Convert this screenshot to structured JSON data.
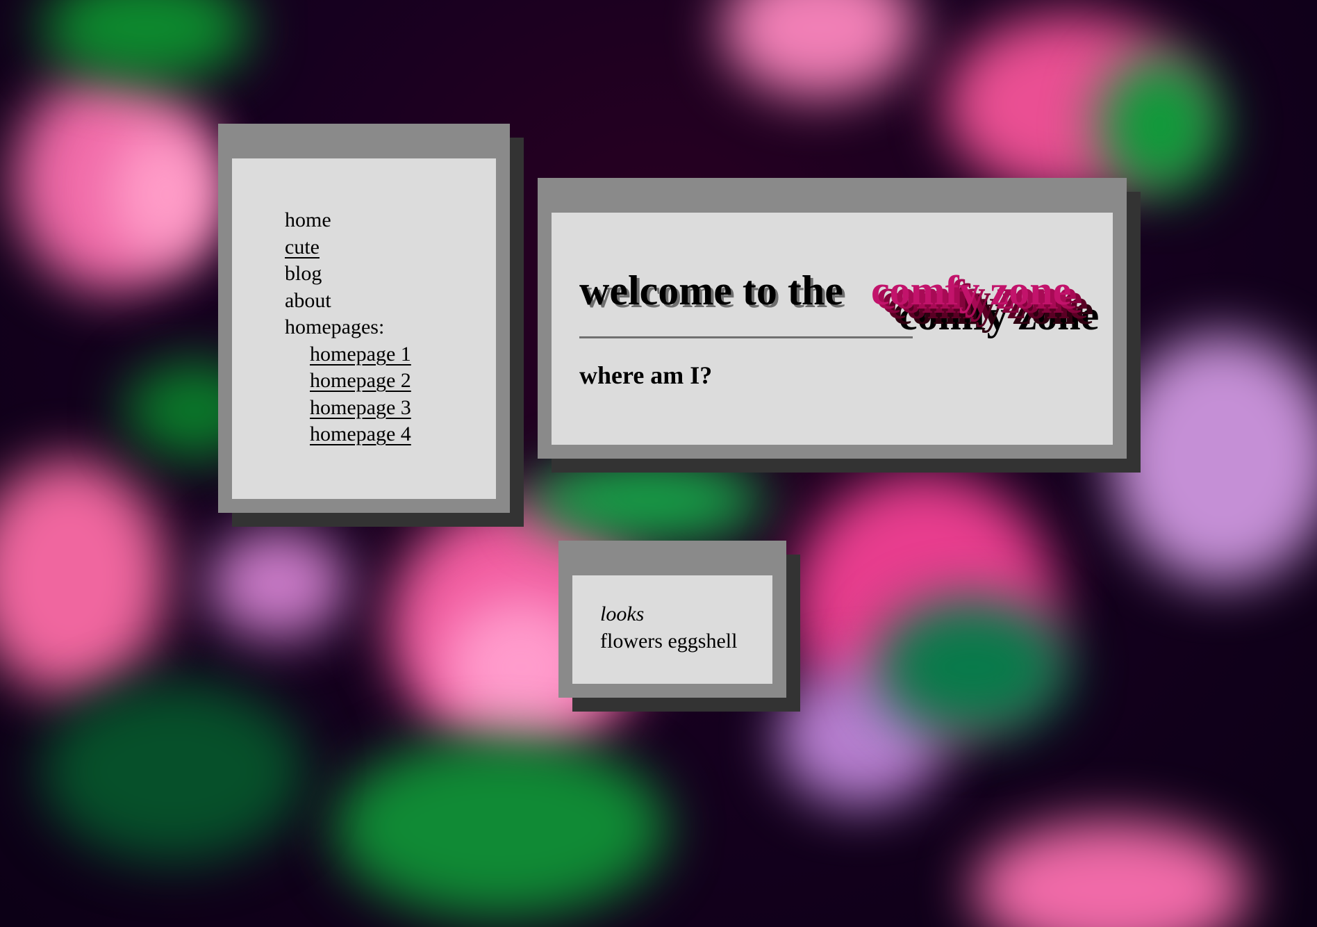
{
  "nav": {
    "items": [
      {
        "label": "home",
        "underlined": false
      },
      {
        "label": "cute",
        "underlined": true
      },
      {
        "label": "blog",
        "underlined": false
      },
      {
        "label": "about",
        "underlined": false
      }
    ],
    "homepages_label": "homepages:",
    "homepages": [
      {
        "label": "homepage 1"
      },
      {
        "label": "homepage 2"
      },
      {
        "label": "homepage 3"
      },
      {
        "label": "homepage 4"
      }
    ]
  },
  "welcome": {
    "title_prefix": "welcome to the",
    "title_highlight": "comfy zone",
    "subtitle": "where am I?"
  },
  "looks": {
    "label": "looks",
    "value": "flowers eggshell"
  },
  "colors": {
    "panel_frame": "#8a8a8a",
    "panel_inner": "#dcdcdc",
    "panel_shadow": "#333333",
    "accent_pink": "#c2136b",
    "background_dark": "#12001e"
  }
}
